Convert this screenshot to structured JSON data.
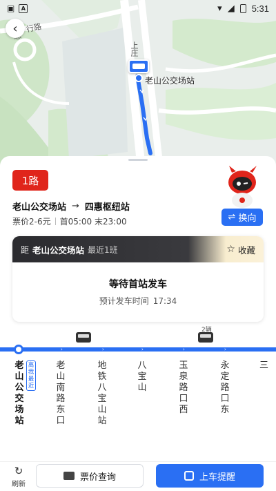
{
  "status_bar": {
    "time": "5:31"
  },
  "map": {
    "road_label_1": "慈",
    "road_label_2": "行路",
    "road_label_3": "上庄",
    "stop_label": "老山公交场站"
  },
  "route": {
    "badge": "1路",
    "from": "老山公交场站",
    "arrow": "→",
    "to": "四惠枢纽站",
    "fare": "票价2-6元",
    "hours": "首05:00 末23:00",
    "swap_label": "换向"
  },
  "wait_card": {
    "prefix": "距",
    "stop": "老山公交场站",
    "recent": "最近1班",
    "favorite_label": "收藏",
    "title": "等待首站发车",
    "sub_label": "预计发车时间",
    "sub_time": "17:34"
  },
  "line": {
    "bus_count": "2辆",
    "near_tag": "离我最近",
    "stations": [
      "老山公交场站",
      "老山南路东口",
      "地铁八宝山站",
      "八宝山",
      "玉泉路口西",
      "永定路口东",
      "三…"
    ]
  },
  "bottom": {
    "refresh_label": "刷新",
    "fare_query_label": "票价查询",
    "alert_label": "上车提醒"
  },
  "colors": {
    "accent": "#2a6ff3",
    "route_red": "#e0251b"
  }
}
